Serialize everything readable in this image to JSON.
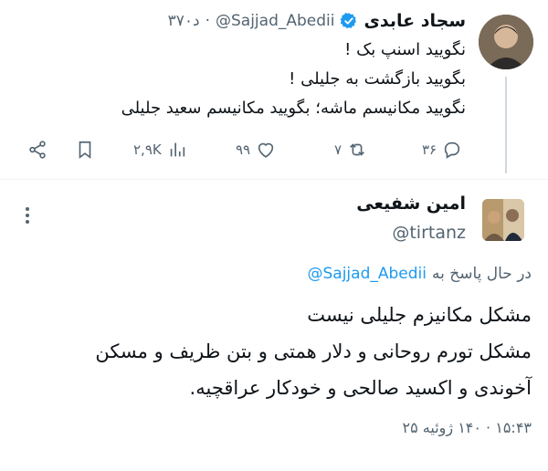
{
  "original_tweet": {
    "author_name": "سجاد عابدی",
    "handle": "@Sajjad_Abedii",
    "time": "۳۷۰د",
    "lines": [
      "نگویید اسنپ بک !",
      "بگویید بازگشت به جلیلی !",
      "نگویید مکانیسم ماشه؛ بگویید مکانیسم سعید جلیلی"
    ],
    "actions": {
      "replies": "۳۶",
      "retweets": "۷",
      "likes": "۹۹",
      "views": "۲,۹K"
    }
  },
  "reply": {
    "author_name": "امین شفیعی",
    "handle": "@tirtanz",
    "replying_to_prefix": "در حال پاسخ به",
    "replying_to_handle": "@Sajjad_Abedii",
    "lines": [
      "مشکل مکانیزم جلیلی نیست",
      "مشکل تورم روحانی و دلار همتی و بتن ظریف و مسکن",
      "آخوندی و اکسید صالحی و خودکار عراقچیه."
    ],
    "timestamp": "۱۵:۴۳ · ۱۴۰ ژوئیه ۲۵"
  },
  "colors": {
    "accent": "#1d9bf0",
    "text": "#0f1419",
    "muted": "#536471",
    "divider": "#eff3f4"
  }
}
